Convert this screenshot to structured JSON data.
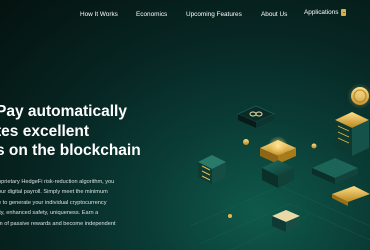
{
  "nav": {
    "how_it_works": "How It Works",
    "economics": "Economics",
    "upcoming_features": "Upcoming Features",
    "about_us": "About Us",
    "applications": "Applications"
  },
  "hero": {
    "headline": [
      "Pay automatically",
      "tes excellent",
      "s on the blockchain"
    ],
    "paragraph": [
      "oprietary HedgeFi risk-reduction algorithm, you",
      "our digital payroll. Simply meet the minimum",
      "e to generate your individual cryptocurrency",
      "ity, enhanced safety, uniqueness. Earn a",
      "m of passive rewards and become independent"
    ]
  },
  "colors": {
    "accent_gold": "#d8b048",
    "background_dark": "#04120f",
    "background_teal": "#0f5a4a"
  }
}
